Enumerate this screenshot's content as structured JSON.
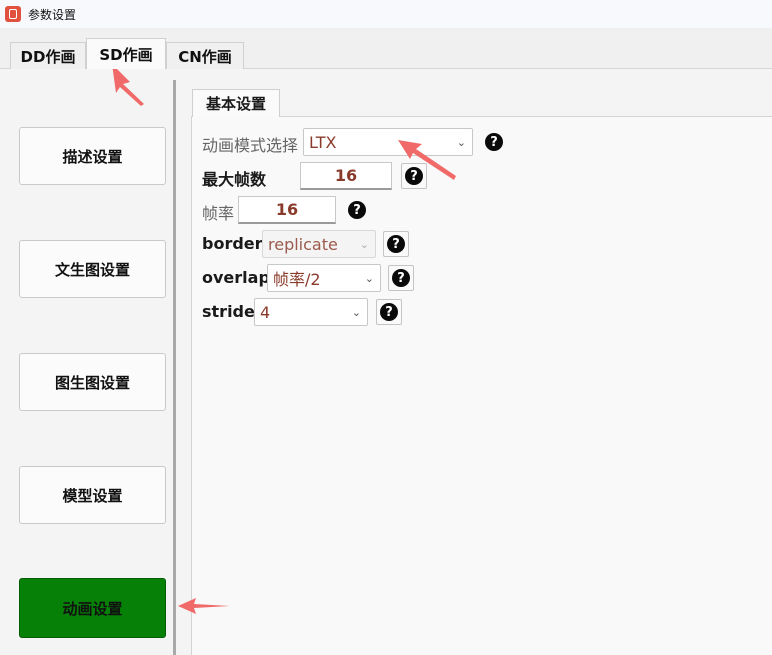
{
  "window": {
    "title": "参数设置"
  },
  "tabs": [
    {
      "label": "DD作画",
      "active": false
    },
    {
      "label": "SD作画",
      "active": true
    },
    {
      "label": "CN作画",
      "active": false
    }
  ],
  "sidebar": {
    "items": [
      {
        "label": "描述设置",
        "active": false
      },
      {
        "label": "文生图设置",
        "active": false
      },
      {
        "label": "图生图设置",
        "active": false
      },
      {
        "label": "模型设置",
        "active": false
      },
      {
        "label": "动画设置",
        "active": true
      }
    ],
    "active_color": "#078007"
  },
  "panel": {
    "tab_label": "基本设置",
    "fields": {
      "animation_mode": {
        "label": "动画模式选择",
        "value": "LTX"
      },
      "max_frames": {
        "label": "最大帧数",
        "value": "16"
      },
      "frame_rate": {
        "label": "帧率",
        "value": "16"
      },
      "border": {
        "label": "border",
        "value": "replicate"
      },
      "overlap": {
        "label": "overlap",
        "value": "帧率/2"
      },
      "stride": {
        "label": "stride",
        "value": "4"
      }
    },
    "help_glyph": "?"
  },
  "colors": {
    "value_text": "#8a3a2a",
    "annotation_arrow": "#f06a6a"
  },
  "icons": {
    "select_chevron": "chevron-down-icon",
    "help": "help-icon",
    "app": "app-icon"
  }
}
